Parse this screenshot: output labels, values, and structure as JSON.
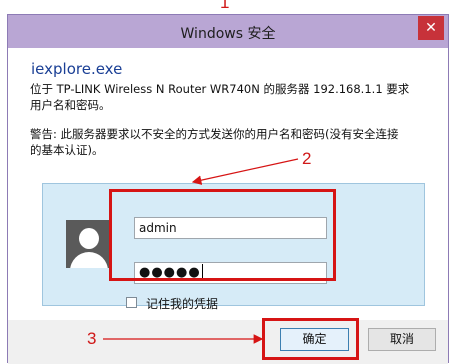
{
  "window": {
    "title": "Windows 安全",
    "close_glyph": "✕"
  },
  "dialog": {
    "app_name": "iexplore.exe",
    "message_line1": "位于 TP-LINK Wireless N Router WR740N 的服务器 192.168.1.1 要求",
    "message_line2": "用户名和密码。",
    "warning_line1": "警告: 此服务器要求以不安全的方式发送你的用户名和密码(没有安全连接",
    "warning_line2": "的基本认证)。"
  },
  "credentials": {
    "username_value": "admin",
    "password_mask": "●●●●●",
    "remember_label": "记住我的凭据",
    "remember_checked": false
  },
  "buttons": {
    "ok_label": "确定",
    "cancel_label": "取消"
  },
  "annotations": {
    "step1": "1",
    "step2": "2",
    "step3": "3",
    "color": "#d61414"
  },
  "colors": {
    "titlebar": "#b9a6d4",
    "close_button": "#c7323a",
    "app_name": "#1a3f95",
    "credential_panel": "#d6ebf7"
  },
  "icons": {
    "avatar": "user-silhouette-icon",
    "close": "close-icon",
    "checkbox": "checkbox-icon"
  }
}
